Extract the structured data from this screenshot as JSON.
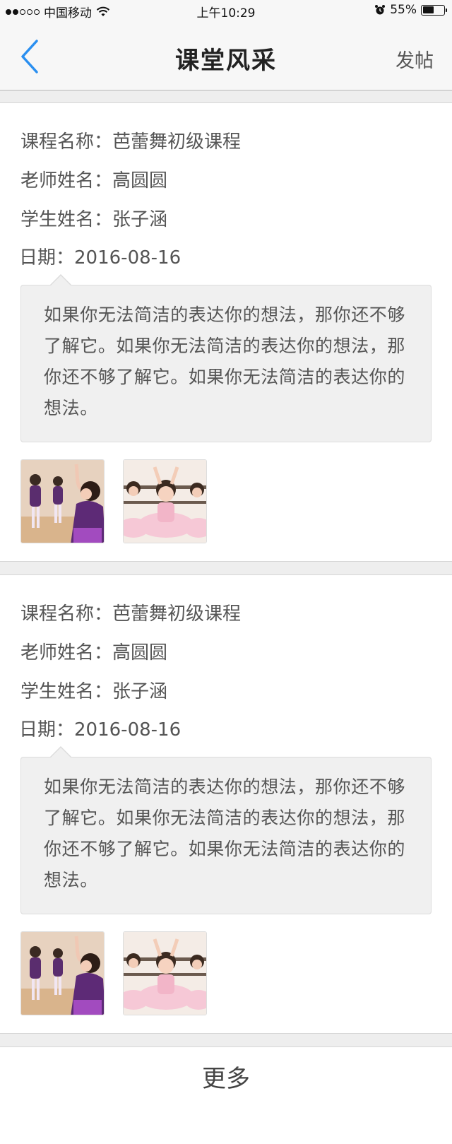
{
  "status_bar": {
    "carrier": "中国移动",
    "time": "上午10:29",
    "battery_text": "55%",
    "battery_level": 0.55,
    "icons": [
      "signal-dots-icon",
      "wifi-icon",
      "alarm-icon",
      "battery-icon"
    ]
  },
  "nav": {
    "title": "课堂风采",
    "post_label": "发帖",
    "back_icon": "chevron-left-icon",
    "accent": "#2a8ff0"
  },
  "posts": [
    {
      "course_label": "课程名称：",
      "course_value": "芭蕾舞初级课程",
      "teacher_label": "老师姓名：",
      "teacher_value": "高圆圆",
      "student_label": "学生姓名：",
      "student_value": "张子涵",
      "date_label": "日期：",
      "date_value": "2016-08-16",
      "comment": "如果你无法简洁的表达你的想法，那你还不够了解它。如果你无法简洁的表达你的想法，那你还不够了解它。如果你无法简洁的表达你的想法。",
      "photos": [
        "ballet-class-photo",
        "ballet-girls-tutu-photo"
      ]
    },
    {
      "course_label": "课程名称：",
      "course_value": "芭蕾舞初级课程",
      "teacher_label": "老师姓名：",
      "teacher_value": "高圆圆",
      "student_label": "学生姓名：",
      "student_value": "张子涵",
      "date_label": "日期：",
      "date_value": "2016-08-16",
      "comment": "如果你无法简洁的表达你的想法，那你还不够了解它。如果你无法简洁的表达你的想法，那你还不够了解它。如果你无法简洁的表达你的想法。",
      "photos": [
        "ballet-class-photo",
        "ballet-girls-tutu-photo"
      ]
    }
  ],
  "more_label": "更多"
}
